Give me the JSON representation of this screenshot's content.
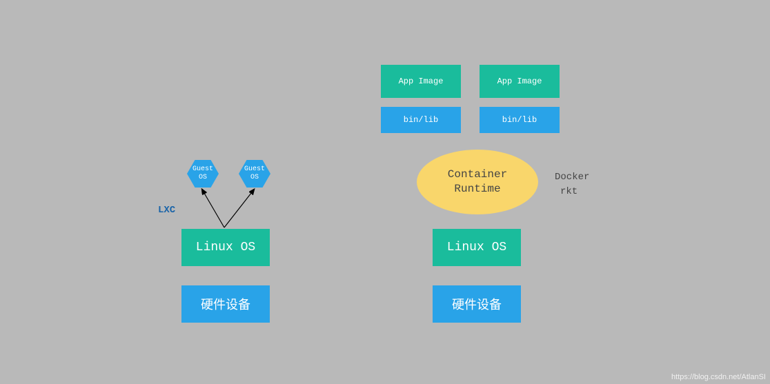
{
  "left": {
    "hex1": "Guest\nOS",
    "hex2": "Guest\nOS",
    "lxc_label": "LXC",
    "linux": "Linux OS",
    "hardware": "硬件设备"
  },
  "right": {
    "app1": "App Image",
    "app2": "App Image",
    "binlib1": "bin/lib",
    "binlib2": "bin/lib",
    "runtime_line1": "Container",
    "runtime_line2": "Runtime",
    "side_label_line1": "Docker",
    "side_label_line2": "rkt",
    "linux": "Linux OS",
    "hardware": "硬件设备"
  },
  "watermark": "https://blog.csdn.net/AtlanSI"
}
